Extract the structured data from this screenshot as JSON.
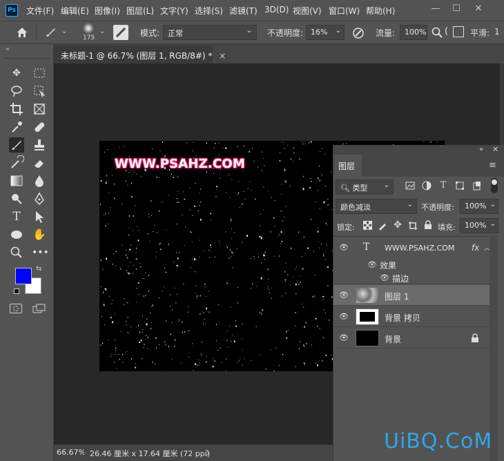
{
  "app": {
    "logo": "Ps"
  },
  "menu": [
    "文件(F)",
    "编辑(E)",
    "图像(I)",
    "图层(L)",
    "文字(Y)",
    "选择(S)",
    "滤镜(T)",
    "3D(D)",
    "视图(V)",
    "窗口(W)",
    "帮助(H)"
  ],
  "window_controls": {
    "minimize": "—",
    "restore": "☐",
    "close": "✕"
  },
  "options_bar": {
    "brush_size": "175",
    "mode_label": "模式:",
    "mode_value": "正常",
    "opacity_label": "不透明度:",
    "opacity_value": "16%",
    "flow_label": "流量:",
    "flow_value": "100%",
    "smoothing_label": "平滑:",
    "smoothing_value": "1"
  },
  "document": {
    "tab_title": "未标题-1 @ 66.7% (图层 1, RGB/8#) *",
    "close": "×",
    "watermark_text": "WWW.PSAHZ.COM"
  },
  "colors": {
    "foreground": "#0000ff",
    "background": "#ffffff",
    "accent": "#31a8ff"
  },
  "status_bar": {
    "zoom": "66.67%",
    "doc_info": "26.46 厘米 x 17.64 厘米 (72 ppi)",
    "arrow": "〉"
  },
  "layers_panel": {
    "tab": "图层",
    "filter_kind": "类型",
    "blend_mode": "颜色减淡",
    "opacity_label": "不透明度:",
    "opacity_value": "100%",
    "lock_label": "锁定:",
    "fill_label": "填充:",
    "fill_value": "100%",
    "layers": [
      {
        "name": "WWW.PSAHZ.COM",
        "type": "text",
        "fx": "fx",
        "effects_label": "效果",
        "stroke_label": "描边"
      },
      {
        "name": "图层 1",
        "type": "pixel",
        "selected": true
      },
      {
        "name": "背景 拷贝",
        "type": "pixel"
      },
      {
        "name": "背景",
        "type": "background",
        "locked": true
      }
    ]
  },
  "site_mark": "UiBQ.CoM"
}
